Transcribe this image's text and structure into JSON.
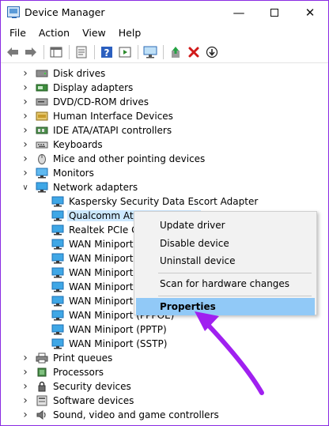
{
  "window": {
    "title": "Device Manager"
  },
  "menu": [
    "File",
    "Action",
    "View",
    "Help"
  ],
  "controls": {
    "minimize": "—",
    "close": "✕"
  },
  "tree": [
    {
      "label": "Disk drives",
      "icon": "disk-drive-icon",
      "expanded": false,
      "level": 0
    },
    {
      "label": "Display adapters",
      "icon": "display-adapter-icon",
      "expanded": false,
      "level": 0
    },
    {
      "label": "DVD/CD-ROM drives",
      "icon": "dvd-drive-icon",
      "expanded": false,
      "level": 0
    },
    {
      "label": "Human Interface Devices",
      "icon": "hid-icon",
      "expanded": false,
      "level": 0
    },
    {
      "label": "IDE ATA/ATAPI controllers",
      "icon": "ide-controller-icon",
      "expanded": false,
      "level": 0
    },
    {
      "label": "Keyboards",
      "icon": "keyboard-icon",
      "expanded": false,
      "level": 0
    },
    {
      "label": "Mice and other pointing devices",
      "icon": "mouse-icon",
      "expanded": false,
      "level": 0
    },
    {
      "label": "Monitors",
      "icon": "monitor-icon",
      "expanded": false,
      "level": 0
    },
    {
      "label": "Network adapters",
      "icon": "network-adapter-icon",
      "expanded": true,
      "level": 0
    },
    {
      "label": "Kaspersky Security Data Escort Adapter",
      "icon": "network-adapter-icon",
      "level": 1
    },
    {
      "label": "Qualcomm Ath",
      "icon": "network-adapter-icon",
      "level": 1,
      "selected": true
    },
    {
      "label": "Realtek PCIe GB",
      "icon": "network-adapter-icon",
      "level": 1
    },
    {
      "label": "WAN Miniport (",
      "icon": "network-adapter-icon",
      "level": 1
    },
    {
      "label": "WAN Miniport (",
      "icon": "network-adapter-icon",
      "level": 1
    },
    {
      "label": "WAN Miniport (",
      "icon": "network-adapter-icon",
      "level": 1
    },
    {
      "label": "WAN Miniport (",
      "icon": "network-adapter-icon",
      "level": 1
    },
    {
      "label": "WAN Miniport (",
      "icon": "network-adapter-icon",
      "level": 1
    },
    {
      "label": "WAN Miniport (PPPOE)",
      "icon": "network-adapter-icon",
      "level": 1
    },
    {
      "label": "WAN Miniport (PPTP)",
      "icon": "network-adapter-icon",
      "level": 1
    },
    {
      "label": "WAN Miniport (SSTP)",
      "icon": "network-adapter-icon",
      "level": 1
    },
    {
      "label": "Print queues",
      "icon": "printer-icon",
      "expanded": false,
      "level": 0
    },
    {
      "label": "Processors",
      "icon": "processor-icon",
      "expanded": false,
      "level": 0
    },
    {
      "label": "Security devices",
      "icon": "security-device-icon",
      "expanded": false,
      "level": 0
    },
    {
      "label": "Software devices",
      "icon": "software-device-icon",
      "expanded": false,
      "level": 0
    },
    {
      "label": "Sound, video and game controllers",
      "icon": "sound-icon",
      "expanded": false,
      "level": 0
    }
  ],
  "context_menu": {
    "items": [
      {
        "label": "Update driver"
      },
      {
        "label": "Disable device"
      },
      {
        "label": "Uninstall device"
      },
      {
        "label": "Scan for hardware changes"
      },
      {
        "label": "Properties",
        "highlighted": true
      }
    ]
  },
  "annotation_color": "#a020f0"
}
